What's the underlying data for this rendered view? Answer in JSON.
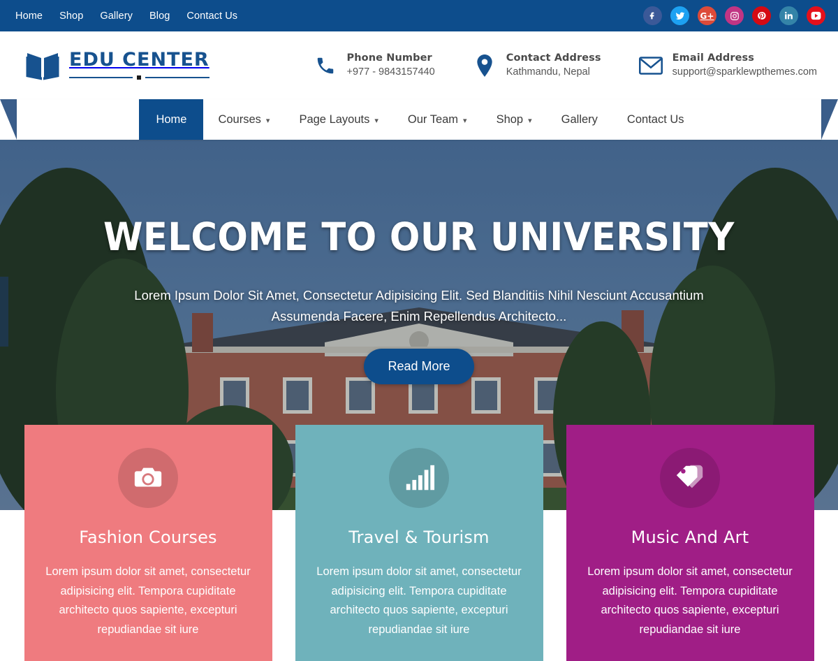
{
  "topbar": {
    "links": [
      {
        "label": "Home",
        "name": "topnav-home"
      },
      {
        "label": "Shop",
        "name": "topnav-shop"
      },
      {
        "label": "Gallery",
        "name": "topnav-gallery"
      },
      {
        "label": "Blog",
        "name": "topnav-blog"
      },
      {
        "label": "Contact Us",
        "name": "topnav-contact-us"
      }
    ],
    "background": "#0d4d8c",
    "socials": [
      {
        "name": "facebook-icon",
        "label": "f",
        "color": "#3b5998"
      },
      {
        "name": "twitter-icon",
        "label": "t",
        "color": "#1da1f2"
      },
      {
        "name": "google-plus-icon",
        "label": "G+",
        "color": "#dd4b39"
      },
      {
        "name": "instagram-icon",
        "label": "ig",
        "color": "#c13584"
      },
      {
        "name": "pinterest-icon",
        "label": "p",
        "color": "#d50a13"
      },
      {
        "name": "linkedin-icon",
        "label": "in",
        "color": "#3484a8"
      },
      {
        "name": "youtube-icon",
        "label": "yt",
        "color": "#e5101a"
      }
    ]
  },
  "header": {
    "logo": {
      "word": "EDU CENTER",
      "icon": "open-book-icon",
      "color": "#17528f"
    },
    "contacts": [
      {
        "icon": "phone-icon",
        "title": "Phone Number",
        "value": "+977 - 9843157440",
        "name": "contact-phone"
      },
      {
        "icon": "map-pin-icon",
        "title": "Contact Address",
        "value": "Kathmandu, Nepal",
        "name": "contact-address"
      },
      {
        "icon": "envelope-icon",
        "title": "Email Address",
        "value": "support@sparklewpthemes.com",
        "name": "contact-email"
      }
    ]
  },
  "mainnav": {
    "items": [
      {
        "label": "Home",
        "caret": false,
        "active": true,
        "name": "nav-home"
      },
      {
        "label": "Courses",
        "caret": true,
        "active": false,
        "name": "nav-courses"
      },
      {
        "label": "Page Layouts",
        "caret": true,
        "active": false,
        "name": "nav-page-layouts"
      },
      {
        "label": "Our Team",
        "caret": true,
        "active": false,
        "name": "nav-our-team"
      },
      {
        "label": "Shop",
        "caret": true,
        "active": false,
        "name": "nav-shop"
      },
      {
        "label": "Gallery",
        "caret": false,
        "active": false,
        "name": "nav-gallery"
      },
      {
        "label": "Contact Us",
        "caret": false,
        "active": false,
        "name": "nav-contact-us"
      }
    ],
    "active_color": "#0d4d8c"
  },
  "hero": {
    "title": "WELCOME TO OUR UNIVERSITY",
    "subtitle": "Lorem Ipsum Dolor Sit Amet, Consectetur Adipisicing Elit. Sed Blanditiis Nihil Nesciunt Accusantium Assumenda Facere, Enim Repellendus Architecto...",
    "button_label": "Read More",
    "button_color": "#0d4d8c"
  },
  "cards": [
    {
      "title": "Fashion Courses",
      "text": "Lorem ipsum dolor sit amet, consectetur adipisicing elit. Tempora cupiditate architecto quos sapiente, excepturi repudiandae sit iure",
      "color": "#ef7b7f",
      "icon": "camera-icon",
      "name": "feature-card-fashion-courses"
    },
    {
      "title": "Travel & Tourism",
      "text": "Lorem ipsum dolor sit amet, consectetur adipisicing elit. Tempora cupiditate architecto quos sapiente, excepturi repudiandae sit iure",
      "color": "#6fb2bb",
      "icon": "bar-chart-icon",
      "name": "feature-card-travel-tourism"
    },
    {
      "title": "Music And Art",
      "text": "Lorem ipsum dolor sit amet, consectetur adipisicing elit. Tempora cupiditate architecto quos sapiente, excepturi repudiandae sit iure",
      "color": "#a01e86",
      "icon": "tags-icon",
      "name": "feature-card-music-and-art"
    }
  ]
}
